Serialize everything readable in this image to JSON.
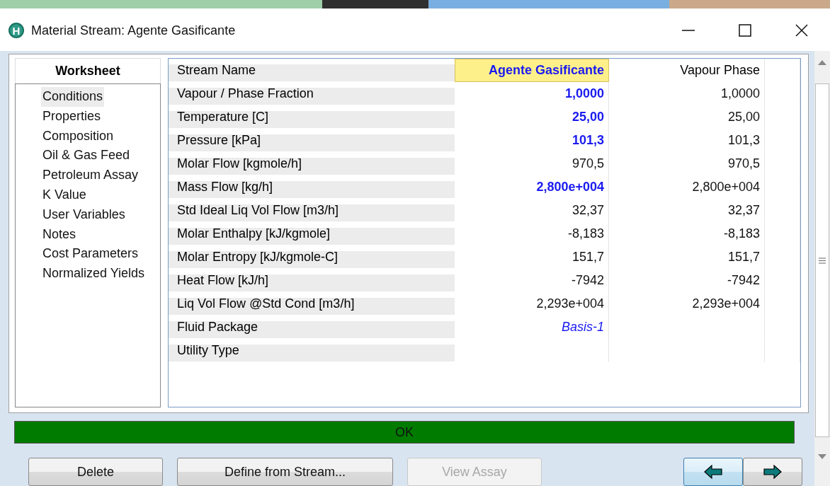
{
  "window": {
    "title": "Material Stream: Agente Gasificante",
    "app_icon_letter": "H"
  },
  "nav": {
    "header": "Worksheet",
    "items": [
      {
        "label": "Conditions",
        "selected": true
      },
      {
        "label": "Properties",
        "selected": false
      },
      {
        "label": "Composition",
        "selected": false
      },
      {
        "label": "Oil & Gas Feed",
        "selected": false
      },
      {
        "label": "Petroleum Assay",
        "selected": false
      },
      {
        "label": "K Value",
        "selected": false
      },
      {
        "label": "User Variables",
        "selected": false
      },
      {
        "label": "Notes",
        "selected": false
      },
      {
        "label": "Cost Parameters",
        "selected": false
      },
      {
        "label": "Normalized Yields",
        "selected": false
      }
    ]
  },
  "table": {
    "header_label": "Stream Name",
    "columns": [
      {
        "name": "Agente Gasificante",
        "selected": true
      },
      {
        "name": "Vapour Phase",
        "selected": false
      }
    ],
    "rows": [
      {
        "label": "Vapour / Phase Fraction",
        "values": [
          {
            "text": "1,0000",
            "kind": "specified"
          },
          {
            "text": "1,0000",
            "kind": "calculated"
          }
        ]
      },
      {
        "label": "Temperature [C]",
        "values": [
          {
            "text": "25,00",
            "kind": "specified"
          },
          {
            "text": "25,00",
            "kind": "calculated"
          }
        ]
      },
      {
        "label": "Pressure [kPa]",
        "values": [
          {
            "text": "101,3",
            "kind": "specified"
          },
          {
            "text": "101,3",
            "kind": "calculated"
          }
        ]
      },
      {
        "label": "Molar Flow [kgmole/h]",
        "values": [
          {
            "text": "970,5",
            "kind": "calculated"
          },
          {
            "text": "970,5",
            "kind": "calculated"
          }
        ]
      },
      {
        "label": "Mass Flow [kg/h]",
        "values": [
          {
            "text": "2,800e+004",
            "kind": "specified"
          },
          {
            "text": "2,800e+004",
            "kind": "calculated"
          }
        ]
      },
      {
        "label": "Std Ideal Liq Vol Flow [m3/h]",
        "values": [
          {
            "text": "32,37",
            "kind": "calculated"
          },
          {
            "text": "32,37",
            "kind": "calculated"
          }
        ]
      },
      {
        "label": "Molar Enthalpy [kJ/kgmole]",
        "values": [
          {
            "text": "-8,183",
            "kind": "calculated"
          },
          {
            "text": "-8,183",
            "kind": "calculated"
          }
        ]
      },
      {
        "label": "Molar Entropy [kJ/kgmole-C]",
        "values": [
          {
            "text": "151,7",
            "kind": "calculated"
          },
          {
            "text": "151,7",
            "kind": "calculated"
          }
        ]
      },
      {
        "label": "Heat Flow [kJ/h]",
        "values": [
          {
            "text": "-7942",
            "kind": "calculated"
          },
          {
            "text": "-7942",
            "kind": "calculated"
          }
        ]
      },
      {
        "label": "Liq Vol Flow @Std Cond [m3/h]",
        "values": [
          {
            "text": "2,293e+004",
            "kind": "calculated"
          },
          {
            "text": "2,293e+004",
            "kind": "calculated"
          }
        ]
      },
      {
        "label": "Fluid Package",
        "values": [
          {
            "text": "Basis-1",
            "kind": "link"
          }
        ]
      },
      {
        "label": "Utility Type",
        "values": []
      }
    ]
  },
  "status": {
    "text": "OK"
  },
  "buttons": [
    {
      "kind": "text",
      "label": "Delete",
      "disabled": false,
      "selected": false
    },
    {
      "kind": "text",
      "label": "Define from Stream...",
      "disabled": false,
      "selected": false
    },
    {
      "kind": "text",
      "label": "View Assay",
      "disabled": true,
      "selected": false
    },
    {
      "kind": "arrow-left",
      "disabled": false,
      "selected": true
    },
    {
      "kind": "arrow-right",
      "disabled": false,
      "selected": false
    }
  ]
}
